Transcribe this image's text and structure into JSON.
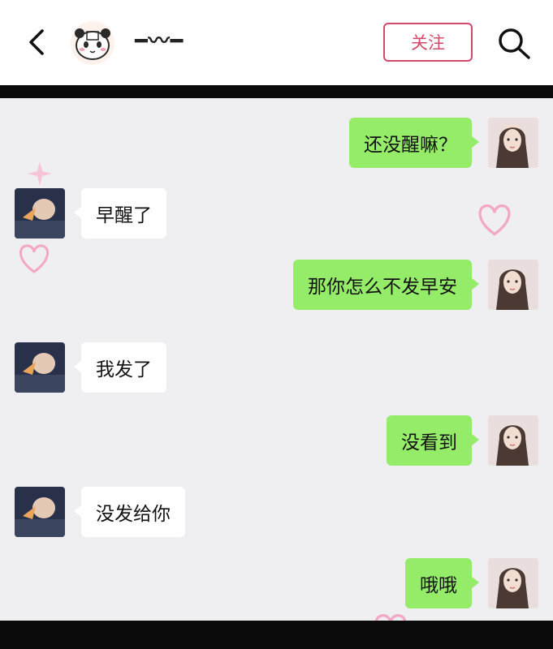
{
  "header": {
    "title": "━〰━",
    "follow_label": "关注",
    "back_icon": "chevron-left-icon",
    "search_icon": "search-icon",
    "avatar_icon": "panda-avatar-icon"
  },
  "chat": {
    "messages": [
      {
        "side": "me",
        "text": "还没醒嘛？"
      },
      {
        "side": "them",
        "text": "早醒了"
      },
      {
        "side": "me",
        "text": "那你怎么不发早安"
      },
      {
        "side": "them",
        "text": "我发了"
      },
      {
        "side": "me",
        "text": "没看到"
      },
      {
        "side": "them",
        "text": "没发给你"
      },
      {
        "side": "me",
        "text": "哦哦"
      }
    ]
  },
  "colors": {
    "accent": "#d24a68",
    "me_bubble": "#95ec69",
    "them_bubble": "#ffffff",
    "chat_background": "#efeef1"
  }
}
